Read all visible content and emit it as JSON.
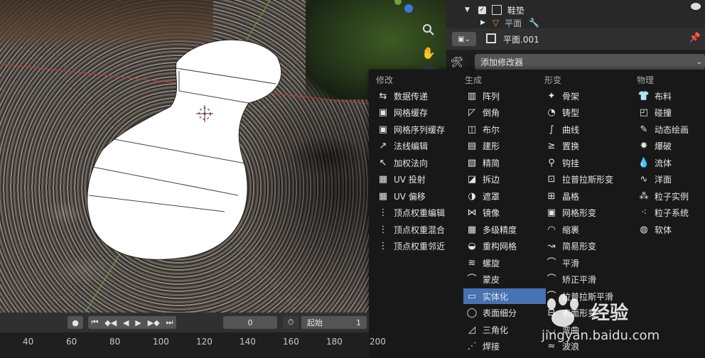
{
  "outliner": {
    "collection_name": "鞋垫",
    "child_name": "平面"
  },
  "properties": {
    "object_name": "平面.001",
    "add_modifier_label": "添加修改器"
  },
  "menu": {
    "columns": [
      {
        "header": "修改",
        "items": [
          {
            "label": "数据传递",
            "icon": "data-transfer-icon"
          },
          {
            "label": "网格缓存",
            "icon": "mesh-cache-icon"
          },
          {
            "label": "网格序列缓存",
            "icon": "mesh-sequence-cache-icon"
          },
          {
            "label": "法线编辑",
            "icon": "normal-edit-icon"
          },
          {
            "label": "加权法向",
            "icon": "weighted-normal-icon"
          },
          {
            "label": "UV 投射",
            "icon": "uv-project-icon"
          },
          {
            "label": "UV 偏移",
            "icon": "uv-warp-icon"
          },
          {
            "label": "顶点权重编辑",
            "icon": "vertex-weight-edit-icon"
          },
          {
            "label": "顶点权重混合",
            "icon": "vertex-weight-mix-icon"
          },
          {
            "label": "顶点权重邻近",
            "icon": "vertex-weight-proximity-icon"
          }
        ]
      },
      {
        "header": "生成",
        "items": [
          {
            "label": "阵列",
            "icon": "array-icon"
          },
          {
            "label": "倒角",
            "icon": "bevel-icon"
          },
          {
            "label": "布尔",
            "icon": "boolean-icon"
          },
          {
            "label": "建形",
            "icon": "build-icon"
          },
          {
            "label": "精简",
            "icon": "decimate-icon"
          },
          {
            "label": "拆边",
            "icon": "edge-split-icon"
          },
          {
            "label": "遮罩",
            "icon": "mask-icon"
          },
          {
            "label": "镜像",
            "icon": "mirror-icon"
          },
          {
            "label": "多级精度",
            "icon": "multires-icon"
          },
          {
            "label": "重构网格",
            "icon": "remesh-icon"
          },
          {
            "label": "螺旋",
            "icon": "screw-icon"
          },
          {
            "label": "蒙皮",
            "icon": "skin-icon"
          },
          {
            "label": "实体化",
            "icon": "solidify-icon"
          },
          {
            "label": "表面细分",
            "icon": "subdivision-icon"
          },
          {
            "label": "三角化",
            "icon": "triangulate-icon"
          },
          {
            "label": "焊接",
            "icon": "weld-icon"
          }
        ]
      },
      {
        "header": "形变",
        "items": [
          {
            "label": "骨架",
            "icon": "armature-icon"
          },
          {
            "label": "铸型",
            "icon": "cast-icon"
          },
          {
            "label": "曲线",
            "icon": "curve-icon"
          },
          {
            "label": "置换",
            "icon": "displace-icon"
          },
          {
            "label": "钩挂",
            "icon": "hook-icon"
          },
          {
            "label": "拉普拉斯形变",
            "icon": "laplacian-deform-icon"
          },
          {
            "label": "晶格",
            "icon": "lattice-icon"
          },
          {
            "label": "网格形变",
            "icon": "mesh-deform-icon"
          },
          {
            "label": "缩裹",
            "icon": "shrinkwrap-icon"
          },
          {
            "label": "简易形变",
            "icon": "simple-deform-icon"
          },
          {
            "label": "平滑",
            "icon": "smooth-icon"
          },
          {
            "label": "矫正平滑",
            "icon": "corrective-smooth-icon"
          },
          {
            "label": "拉普拉斯平滑",
            "icon": "laplacian-smooth-icon"
          },
          {
            "label": "表面形变",
            "icon": "surface-deform-icon"
          },
          {
            "label": "弯曲",
            "icon": "warp-icon"
          },
          {
            "label": "波浪",
            "icon": "wave-icon"
          }
        ]
      },
      {
        "header": "物理",
        "items": [
          {
            "label": "布料",
            "icon": "cloth-icon"
          },
          {
            "label": "碰撞",
            "icon": "collision-icon"
          },
          {
            "label": "动态绘画",
            "icon": "dynamic-paint-icon"
          },
          {
            "label": "爆破",
            "icon": "explode-icon"
          },
          {
            "label": "流体",
            "icon": "fluid-icon"
          },
          {
            "label": "洋面",
            "icon": "ocean-icon"
          },
          {
            "label": "粒子实例",
            "icon": "particle-instance-icon"
          },
          {
            "label": "粒子系统",
            "icon": "particle-system-icon"
          },
          {
            "label": "软体",
            "icon": "soft-body-icon"
          }
        ]
      }
    ],
    "selected": "实体化",
    "accent": "#4772b3"
  },
  "timeline": {
    "current_frame": "0",
    "start_label": "起始",
    "start_value": "1",
    "ruler_ticks": [
      "40",
      "60",
      "80",
      "100",
      "120",
      "140",
      "160",
      "180",
      "200"
    ]
  },
  "watermark": {
    "brand": "经验",
    "url": "jingyan.baidu.com"
  }
}
